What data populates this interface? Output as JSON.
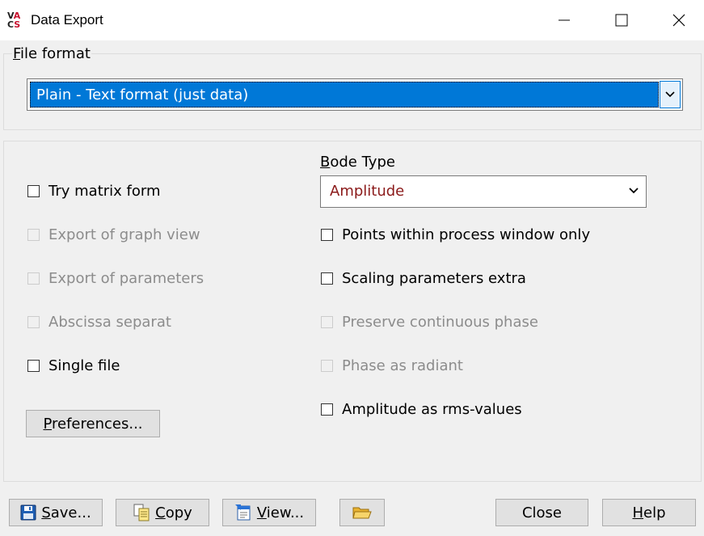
{
  "window": {
    "title": "Data Export",
    "app_icon_letters": [
      "V",
      "A",
      "C",
      "S"
    ]
  },
  "file_format": {
    "label_accel": "F",
    "label_rest": "ile format",
    "selected": "Plain - Text format (just data)"
  },
  "options_left": [
    {
      "label": "Try matrix form",
      "enabled": true,
      "checked": false
    },
    {
      "label": "Export of graph view",
      "enabled": false,
      "checked": false
    },
    {
      "label": "Export of parameters",
      "enabled": false,
      "checked": false
    },
    {
      "label": "Abscissa separat",
      "enabled": false,
      "checked": false
    },
    {
      "label": "Single file",
      "enabled": true,
      "checked": false
    }
  ],
  "bode_type": {
    "label_accel": "B",
    "label_rest": "ode Type",
    "selected": "Amplitude"
  },
  "options_right": [
    {
      "label": "Points within process window only",
      "enabled": true,
      "checked": false
    },
    {
      "label": "Scaling parameters extra",
      "enabled": true,
      "checked": false
    },
    {
      "label": "Preserve continuous phase",
      "enabled": false,
      "checked": false
    },
    {
      "label": "Phase as radiant",
      "enabled": false,
      "checked": false
    },
    {
      "label": "Amplitude as rms-values",
      "enabled": true,
      "checked": false
    }
  ],
  "preferences_button": {
    "accel": "P",
    "rest": "references..."
  },
  "footer": {
    "save": {
      "accel": "S",
      "rest": "ave..."
    },
    "copy": {
      "accel": "C",
      "rest": "opy"
    },
    "view": {
      "accel": "V",
      "rest": "iew..."
    },
    "close": "Close",
    "help": {
      "accel": "H",
      "rest": "elp"
    }
  },
  "icons": {
    "save": "floppy-disk-icon",
    "copy": "copy-icon",
    "view": "view-document-icon",
    "folder": "folder-open-icon",
    "minimize": "minimize-icon",
    "maximize": "maximize-icon",
    "close": "close-icon"
  },
  "colors": {
    "selection": "#0078d7",
    "bode_value": "#8b1a1a",
    "disabled_text": "#8c8c8c"
  }
}
